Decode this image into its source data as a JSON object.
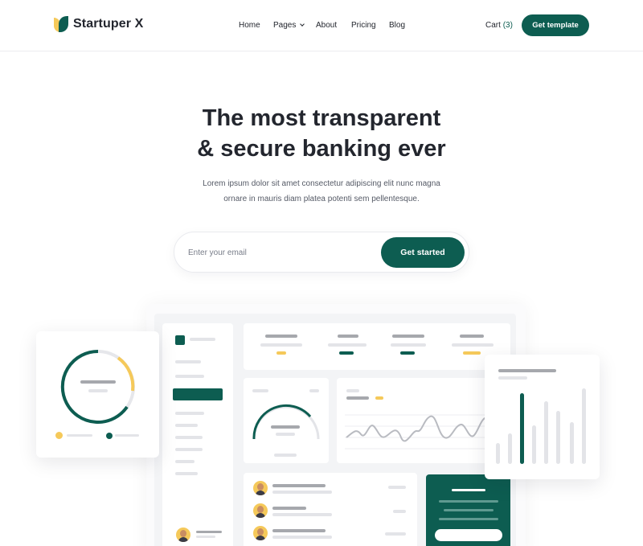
{
  "nav": {
    "brand": "Startuper X",
    "links": [
      "Home",
      "Pages",
      "About",
      "Pricing",
      "Blog"
    ],
    "cart_label": "Cart",
    "cart_count": "(3)",
    "cta": "Get template"
  },
  "hero": {
    "title_line1": "The most transparent",
    "title_line2": "& secure banking ever",
    "subtitle_line1": "Lorem ipsum dolor sit amet consectetur adipiscing elit nunc magna",
    "subtitle_line2": "ornare in mauris diam platea potenti sem pellentesque.",
    "email_placeholder": "Enter your email",
    "cta": "Get started"
  },
  "colors": {
    "brand_green": "#0d5d51",
    "accent_yellow": "#f5c95a"
  }
}
